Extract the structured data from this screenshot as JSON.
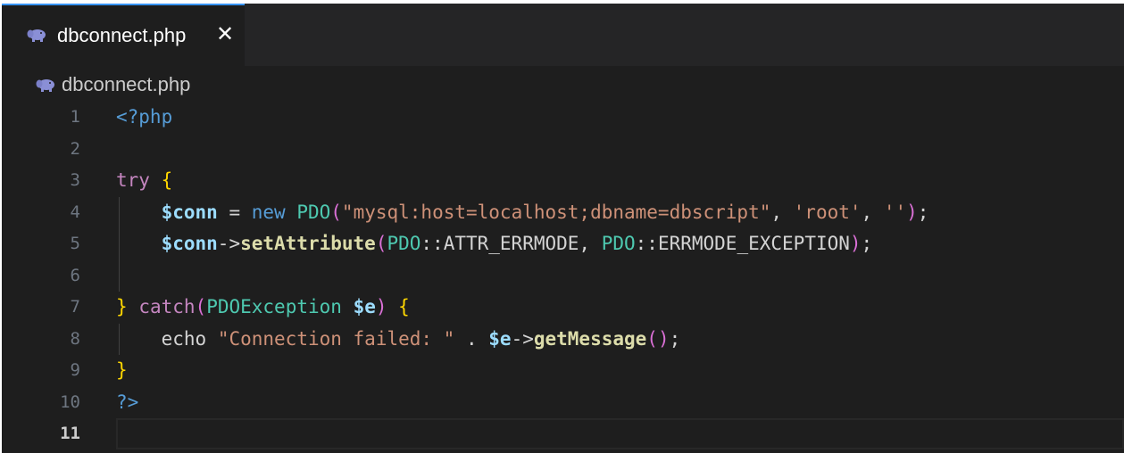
{
  "tab": {
    "filename": "dbconnect.php",
    "close_glyph": "✕",
    "icon": "php-elephant-icon",
    "accent": "#3794ff"
  },
  "breadcrumb": {
    "filename": "dbconnect.php",
    "icon": "php-elephant-icon"
  },
  "editor": {
    "language": "php",
    "active_line": 11,
    "lines": [
      {
        "n": "1",
        "tokens": [
          [
            "t-tag",
            "<?php"
          ]
        ]
      },
      {
        "n": "2",
        "tokens": []
      },
      {
        "n": "3",
        "tokens": [
          [
            "t-kw",
            "try"
          ],
          [
            "t-plain",
            " "
          ],
          [
            "t-brace",
            "{"
          ]
        ]
      },
      {
        "n": "4",
        "tokens": [
          [
            "t-plain",
            "    "
          ],
          [
            "t-var",
            "$conn"
          ],
          [
            "t-plain",
            " = "
          ],
          [
            "t-new",
            "new"
          ],
          [
            "t-plain",
            " "
          ],
          [
            "t-class",
            "PDO"
          ],
          [
            "t-brace2",
            "("
          ],
          [
            "t-str",
            "\"mysql:host=localhost;dbname=dbscript\""
          ],
          [
            "t-plain",
            ", "
          ],
          [
            "t-str",
            "'root'"
          ],
          [
            "t-plain",
            ", "
          ],
          [
            "t-str",
            "''"
          ],
          [
            "t-brace2",
            ")"
          ],
          [
            "t-plain",
            ";"
          ]
        ]
      },
      {
        "n": "5",
        "tokens": [
          [
            "t-plain",
            "    "
          ],
          [
            "t-var",
            "$conn"
          ],
          [
            "t-plain",
            "->"
          ],
          [
            "t-fn",
            "setAttribute"
          ],
          [
            "t-brace2",
            "("
          ],
          [
            "t-class",
            "PDO"
          ],
          [
            "t-plain",
            "::"
          ],
          [
            "t-const",
            "ATTR_ERRMODE"
          ],
          [
            "t-plain",
            ", "
          ],
          [
            "t-class",
            "PDO"
          ],
          [
            "t-plain",
            "::"
          ],
          [
            "t-const",
            "ERRMODE_EXCEPTION"
          ],
          [
            "t-brace2",
            ")"
          ],
          [
            "t-plain",
            ";"
          ]
        ]
      },
      {
        "n": "6",
        "tokens": []
      },
      {
        "n": "7",
        "tokens": [
          [
            "t-brace",
            "}"
          ],
          [
            "t-plain",
            " "
          ],
          [
            "t-kw",
            "catch"
          ],
          [
            "t-brace2",
            "("
          ],
          [
            "t-class",
            "PDOException"
          ],
          [
            "t-plain",
            " "
          ],
          [
            "t-var",
            "$e"
          ],
          [
            "t-brace2",
            ")"
          ],
          [
            "t-plain",
            " "
          ],
          [
            "t-brace",
            "{"
          ]
        ]
      },
      {
        "n": "8",
        "tokens": [
          [
            "t-plain",
            "    "
          ],
          [
            "t-echo",
            "echo"
          ],
          [
            "t-plain",
            " "
          ],
          [
            "t-str",
            "\"Connection failed: \""
          ],
          [
            "t-plain",
            " . "
          ],
          [
            "t-var",
            "$e"
          ],
          [
            "t-plain",
            "->"
          ],
          [
            "t-fn",
            "getMessage"
          ],
          [
            "t-brace2",
            "()"
          ],
          [
            "t-plain",
            ";"
          ]
        ]
      },
      {
        "n": "9",
        "tokens": [
          [
            "t-brace",
            "}"
          ]
        ]
      },
      {
        "n": "10",
        "tokens": [
          [
            "t-tag",
            "?>"
          ]
        ]
      },
      {
        "n": "11",
        "tokens": []
      }
    ]
  }
}
